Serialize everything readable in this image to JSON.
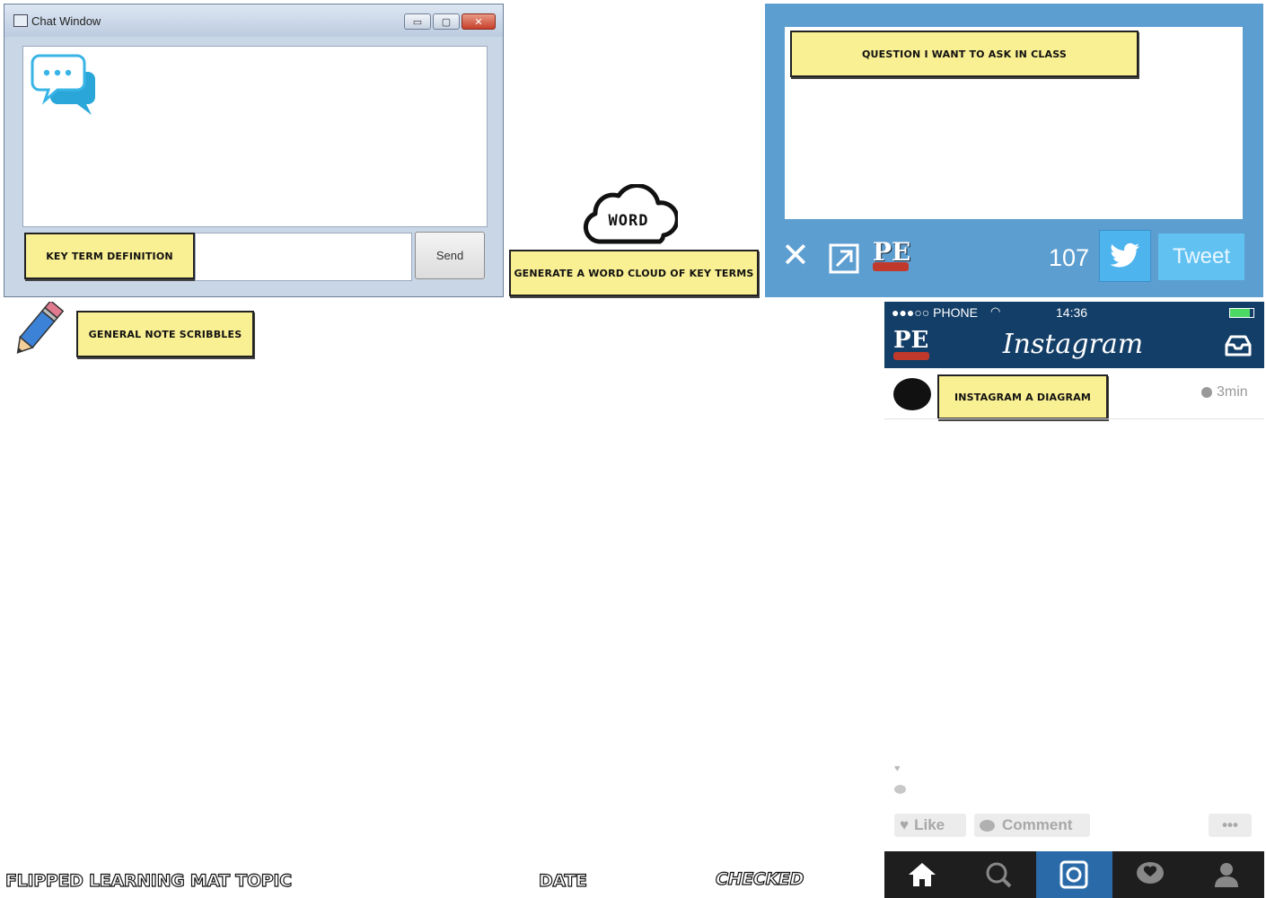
{
  "chat_window": {
    "title": "Chat Window",
    "key_term_label": "Key term definition",
    "send_label": "Send"
  },
  "word_cloud": {
    "cloud_text": "WORD",
    "label": "Generate a word cloud of key terms"
  },
  "twitter": {
    "question_label": "Question I want to ask in class",
    "count": "107",
    "tweet_label": "Tweet",
    "logo_text": "PE"
  },
  "notes": {
    "general_label": "General note scribbles"
  },
  "instagram": {
    "carrier": "●●●○○ PHONE",
    "time": "14:36",
    "logo_text": "PE",
    "brand": "Instagram",
    "post_label": "Instagram a diagram",
    "post_time": "3min",
    "like_label": "Like",
    "comment_label": "Comment",
    "more_label": "•••"
  },
  "footer": {
    "topic": "Flipped Learning Mat Topic",
    "date": "Date",
    "checked": "Checked"
  },
  "colors": {
    "note_yellow": "#f9ef93",
    "twitter_blue": "#5d9ed1",
    "instagram_navy": "#133e67"
  }
}
